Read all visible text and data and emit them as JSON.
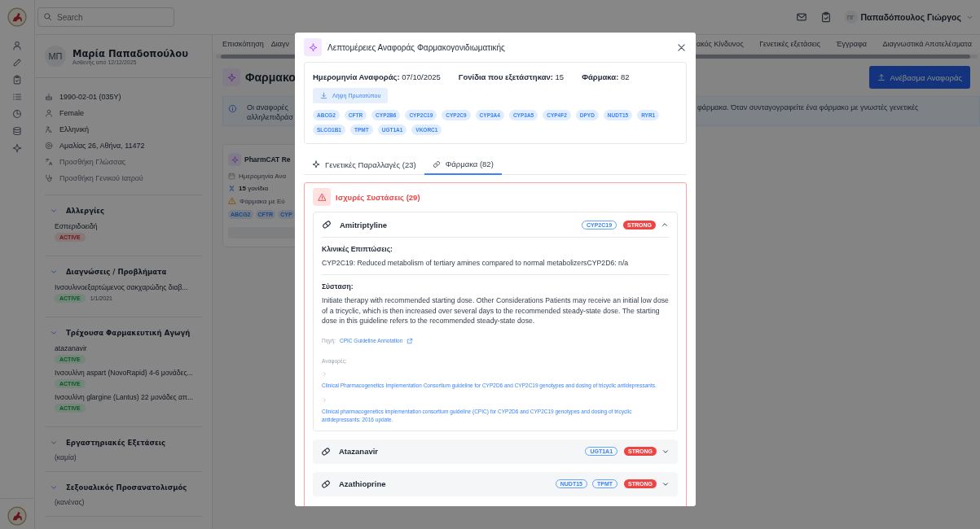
{
  "topbar": {
    "search": {
      "placeholder": "Search"
    },
    "user": {
      "initials": "ΠΓ",
      "name": "Παπαδόπουλος Γιώργος"
    }
  },
  "patient": {
    "initials": "ΜΠ",
    "name": "Μαρία Παπαδοπούλου",
    "subtitle": "Ασθενής από 12/12/2025",
    "details": [
      {
        "text": "1990-02-01 (035Y)",
        "kind": "value"
      },
      {
        "text": "Female",
        "kind": "value"
      },
      {
        "text": "Ελληνική",
        "kind": "value"
      },
      {
        "text": "Αμαλίας 26, Αθήνα, 11472",
        "kind": "value"
      },
      {
        "text": "Προσθήκη Γλώσσας",
        "kind": "add"
      },
      {
        "text": "Προσθήκη Γενικού Ιατρού",
        "kind": "add"
      }
    ],
    "sections": [
      {
        "title": "Αλλεργίες",
        "expanded": true,
        "items": [
          {
            "name": "Εσπεριδοειδή",
            "status": "ACTIVE",
            "kind": "danger"
          }
        ]
      },
      {
        "title": "Διαγνώσεις / Προβλήματα",
        "expanded": true,
        "items": [
          {
            "name": "Ινσουλινοεξαρτώμενος σακχαρώδης διαβ...",
            "status": "ACTIVE",
            "kind": "success",
            "date": "1/1/2021"
          }
        ]
      },
      {
        "title": "Τρέχουσα Φαρμακευτική Αγωγή",
        "expanded": true,
        "items": [
          {
            "name": "atazanavir",
            "status": "ACTIVE",
            "kind": "success"
          },
          {
            "name": "Ινσουλίνη aspart (NovoRapid) 4-6 μονάδες...",
            "status": "ACTIVE",
            "kind": "success"
          },
          {
            "name": "Ινσουλίνη glargine (Lantus) 22 μονάδες απ...",
            "status": "ACTIVE",
            "kind": "success"
          }
        ]
      },
      {
        "title": "Εργαστηριακές Εξετάσεις",
        "expanded": true,
        "empty_text": "(καμία)"
      },
      {
        "title": "Σεξουαλικός Προσανατολισμός",
        "expanded": true,
        "empty_text": "(κανένας)"
      }
    ]
  },
  "page": {
    "tabs_left": [
      {
        "label": "Επισκόπηση",
        "selected": false
      },
      {
        "label": "Διαγν",
        "selected": false
      }
    ],
    "tabs_right": [
      {
        "label": "ακός Κίνδυνος",
        "selected": false
      },
      {
        "label": "Γενετικές εξετάσεις",
        "selected": false
      },
      {
        "label": "Έγγραφα",
        "selected": false
      },
      {
        "label": "Διαγνωστικά Αποτελέσματα",
        "selected": false
      }
    ],
    "title": "Φαρμακο",
    "upload_button": "Ανέβασμα Αναφοράς",
    "info": {
      "left_lines": [
        "Οι αναφορές",
        "αλληλεπιδράσ"
      ],
      "right_lines": [
        "φάρμακα. Όταν συνταγογραφείτε ένα φάρμακο με γνωστές γενετικές"
      ]
    },
    "report_card": {
      "title": "PharmCAT Re",
      "date": "Ημερομηνία Ανα",
      "genes": "**15** γονίδια",
      "drugs": "Φάρμακα με Εύ",
      "chips": [
        "ABCG2",
        "CFTR",
        "CYP"
      ]
    }
  },
  "modal": {
    "title": "Λεπτομέρειες Αναφοράς Φαρμακογονιδιωματικής",
    "summary": [
      "**Ημερομηνία Αναφοράς:** 07/10/2025",
      "**Γονίδια που εξετάστηκαν:** 15",
      "**Φάρμακα:** 82"
    ],
    "download_button": "Λήψη Πρωτοτύπου",
    "genes": [
      "ABCG2",
      "CFTR",
      "CYP2B6",
      "CYP2C19",
      "CYP2C9",
      "CYP3A4",
      "CYP3A5",
      "CYP4F2",
      "DPYD",
      "NUDT15",
      "RYR1",
      "SLCO1B1",
      "TPMT",
      "UGT1A1",
      "VKORC1"
    ],
    "tabs": [
      {
        "label": "Γενετικές Παραλλαγές (23)",
        "selected": false
      },
      {
        "label": "Φάρμακα (82)",
        "selected": true
      }
    ],
    "group": {
      "title": "Ισχυρές Συστάσεις (29)",
      "drugs": [
        {
          "name": "Amitriptyline",
          "genes": [
            "CYP2C19"
          ],
          "strength": "STRONG",
          "expanded": true,
          "details": {
            "implications_label": "Κλινικές Επιπτώσεις:",
            "implications": "CYP2C19: Reduced metabolism of tertiary amines compared to normal metabolizersCYP2D6: n/a",
            "recommendation_label": "Σύσταση:",
            "recommendation": "Initiate therapy with recommended starting dose. Other Considerations Patients may receive an initial low dose of a tricyclic, which is then increased over several days to the recommended steady-state dose. The starting dose in this guideline refers to the recommended steady-state dose.",
            "source_label": "Πηγή:",
            "source_link": "CPIC Guideline Annotation",
            "references_label": "Αναφορές:",
            "references": [
              "Clinical Pharmacogenetics Implementation Consortium guideline for CYP2D6 and CYP2C19 genotypes and dosing of tricyclic antidepressants.",
              "Clinical pharmacogenetics implementation consortium guideline (CPIC) for CYP2D6 and CYP2C19 genotypes and dosing of tricyclic antidepressants: 2016 update."
            ]
          }
        },
        {
          "name": "Atazanavir",
          "genes": [
            "UGT1A1"
          ],
          "strength": "STRONG",
          "expanded": false
        },
        {
          "name": "Azathioprine",
          "genes": [
            "NUDT15",
            "TPMT"
          ],
          "strength": "STRONG",
          "expanded": false
        }
      ]
    }
  }
}
